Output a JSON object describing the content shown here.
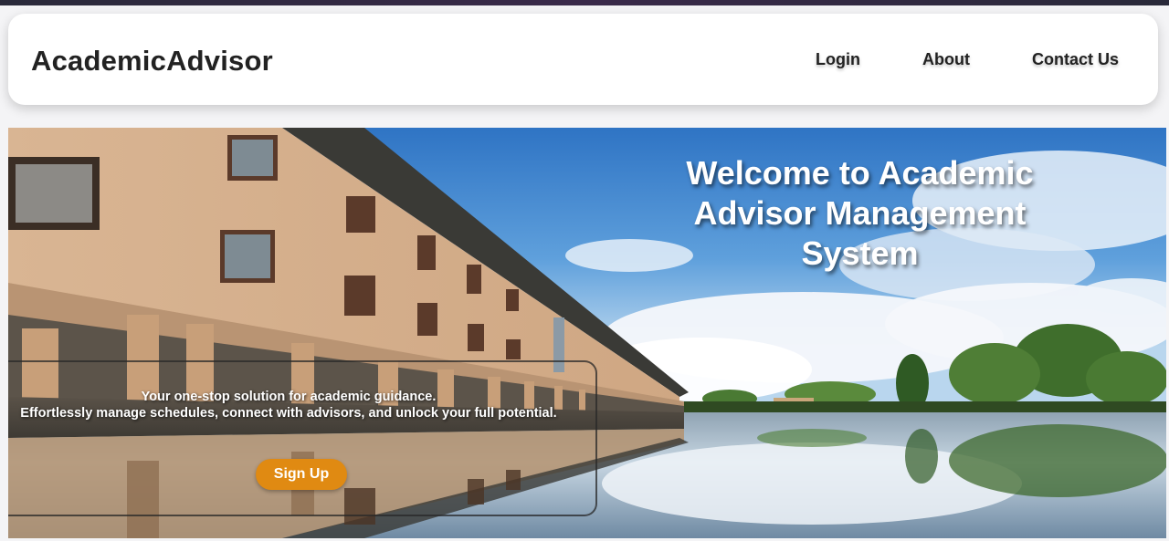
{
  "navbar": {
    "brand": "AcademicAdvisor",
    "links": [
      "Login",
      "About",
      "Contact Us"
    ]
  },
  "hero": {
    "title": "Welcome to Academic Advisor Management System",
    "tagline_line1": "Your one-stop solution for academic guidance.",
    "tagline_line2": "Effortlessly manage schedules, connect with advisors, and unlock your full potential.",
    "signup_label": "Sign Up"
  },
  "colors": {
    "accent": "#e08a12",
    "navbar_bg": "#ffffff",
    "text_dark": "#222222"
  }
}
